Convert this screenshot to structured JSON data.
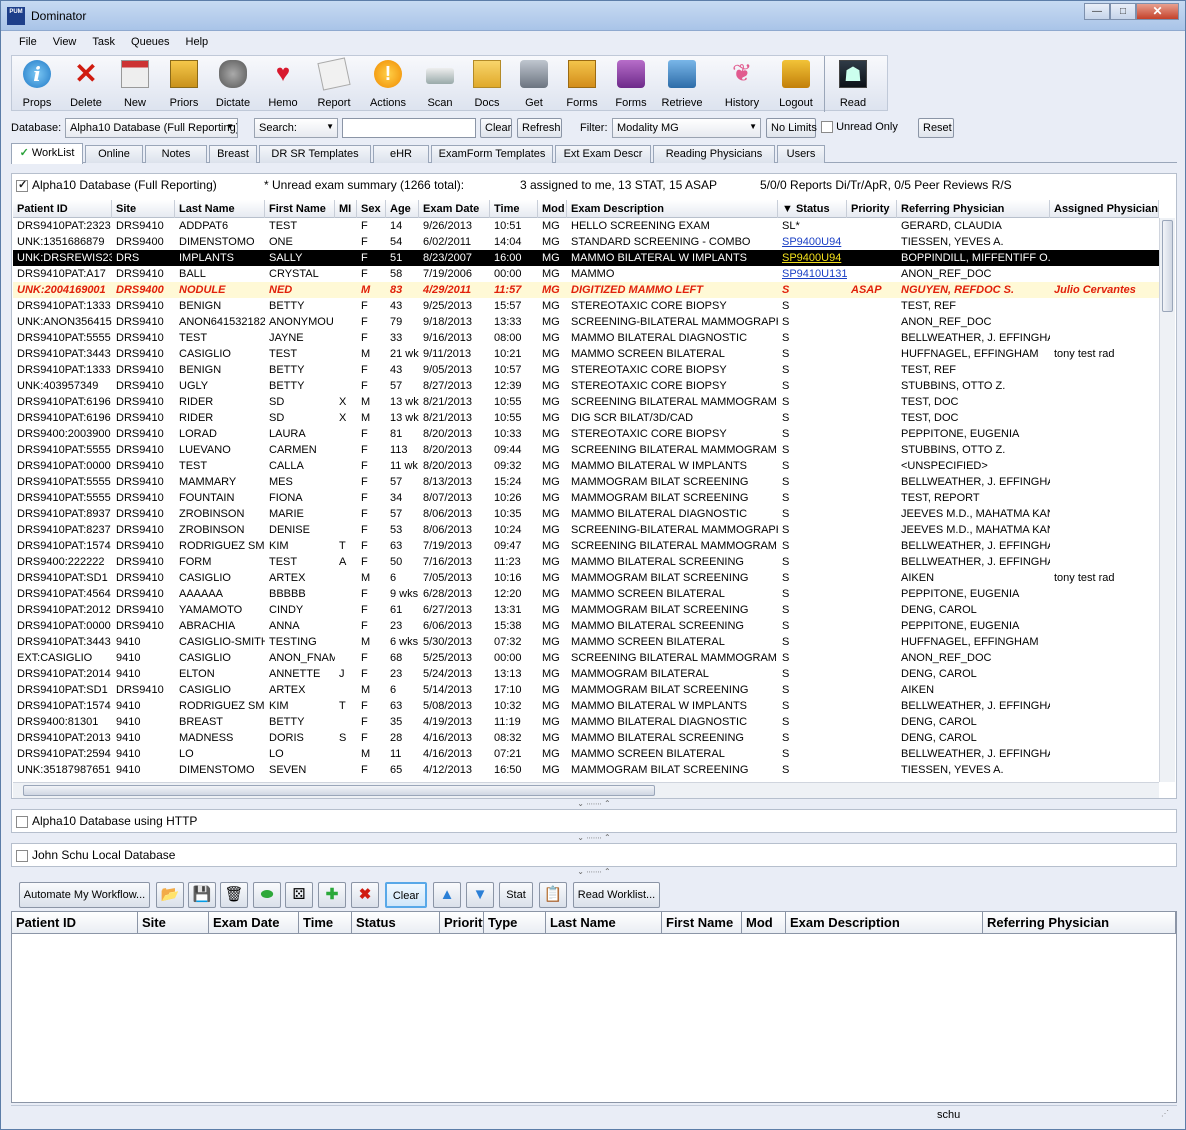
{
  "window": {
    "title": "Dominator",
    "logo": "PUM",
    "btn_min": "—",
    "btn_max": "□",
    "btn_close": "✕"
  },
  "menu": [
    "File",
    "View",
    "Task",
    "Queues",
    "Help"
  ],
  "toolbar": [
    {
      "label": "Props",
      "icon": "props-icon",
      "glyph": "i"
    },
    {
      "label": "Delete",
      "icon": "delete-icon",
      "glyph": "✕"
    },
    {
      "label": "New",
      "icon": "calendar-icon",
      "glyph": ""
    },
    {
      "label": "Priors",
      "icon": "folder-icon",
      "glyph": ""
    },
    {
      "label": "Dictate",
      "icon": "microphone-icon",
      "glyph": ""
    },
    {
      "label": "Hemo",
      "icon": "heart-icon",
      "glyph": "♥"
    },
    {
      "label": "Report",
      "icon": "report-icon",
      "glyph": ""
    },
    {
      "label": "Actions",
      "icon": "exclamation-icon",
      "glyph": "!"
    },
    {
      "label": "Scan",
      "icon": "scanner-icon",
      "glyph": ""
    },
    {
      "label": "Docs",
      "icon": "docs-icon",
      "glyph": ""
    },
    {
      "label": "Get",
      "icon": "camera-icon",
      "glyph": ""
    },
    {
      "label": "Forms",
      "icon": "forms-icon",
      "glyph": ""
    },
    {
      "label": "Forms",
      "icon": "print-forms-icon",
      "glyph": ""
    },
    {
      "label": "Retrieve",
      "icon": "retrieve-icon",
      "glyph": ""
    },
    {
      "label": "History",
      "icon": "ribbon-icon",
      "glyph": "❦"
    },
    {
      "label": "Logout",
      "icon": "lock-icon",
      "glyph": ""
    },
    {
      "label": "Read",
      "icon": "xray-icon",
      "glyph": "☗"
    }
  ],
  "filterbar": {
    "database_label": "Database:",
    "database_value": "Alpha10 Database (Full Reporting)",
    "search_dropdown": "Search:",
    "search_value": "",
    "clear": "Clear",
    "refresh": "Refresh",
    "filter_label": "Filter:",
    "filter_value": "Modality MG",
    "no_limits": "No Limits",
    "unread_only": "Unread Only",
    "reset": "Reset"
  },
  "tabs": [
    "WorkList",
    "Online",
    "Notes",
    "Breast",
    "DR SR Templates",
    "eHR",
    "ExamForm Templates",
    "Ext Exam Descr",
    "Reading Physicians",
    "Users"
  ],
  "section1": {
    "title": "Alpha10 Database (Full Reporting)",
    "summary1": "* Unread exam summary (1266 total):",
    "summary2": "3 assigned to me, 13 STAT, 15 ASAP",
    "summary3": "5/0/0 Reports Di/Tr/ApR, 0/5 Peer Reviews R/S"
  },
  "columns": [
    "Patient ID",
    "Site",
    "Last Name",
    "First Name",
    "MI",
    "Sex",
    "Age",
    "Exam Date",
    "Time",
    "Mod",
    "Exam Description",
    "▼ Status",
    "Priority",
    "Referring Physician",
    "Assigned Physician"
  ],
  "rows": [
    [
      "DRS9410PAT:2323",
      "DRS9410",
      "ADDPAT6",
      "TEST",
      "",
      "F",
      "14",
      "9/26/2013",
      "10:51",
      "MG",
      "HELLO SCREENING EXAM",
      "SL*",
      "",
      "GERARD, CLAUDIA",
      ""
    ],
    [
      "UNK:1351686879",
      "DRS9400",
      "DIMENSTOMO",
      "ONE",
      "",
      "F",
      "54",
      "6/02/2011",
      "14:04",
      "MG",
      "STANDARD SCREENING - COMBO",
      "SP9400U94",
      "",
      "TIESSEN, YEVES A.",
      ""
    ],
    [
      "UNK:DRSREWIS23",
      "DRS",
      "IMPLANTS",
      "SALLY",
      "",
      "F",
      "51",
      "8/23/2007",
      "16:00",
      "MG",
      "MAMMO BILATERAL W IMPLANTS",
      "SP9400U94",
      "",
      "BOPPINDILL, MIFFENTIFF O.",
      ""
    ],
    [
      "DRS9410PAT:A17",
      "DRS9410",
      "BALL",
      "CRYSTAL",
      "",
      "F",
      "58",
      "7/19/2006",
      "00:00",
      "MG",
      "MAMMO",
      "SP9410U131",
      "",
      "ANON_REF_DOC",
      ""
    ],
    [
      "UNK:2004169001",
      "DRS9400",
      "NODULE",
      "NED",
      "",
      "M",
      "83",
      "4/29/2011",
      "11:57",
      "MG",
      "DIGITIZED MAMMO LEFT",
      "S",
      "ASAP",
      "NGUYEN, REFDOC S.",
      "Julio Cervantes"
    ],
    [
      "DRS9410PAT:1333",
      "DRS9410",
      "BENIGN",
      "BETTY",
      "",
      "F",
      "43",
      "9/25/2013",
      "15:57",
      "MG",
      "STEREOTAXIC CORE BIOPSY",
      "S",
      "",
      "TEST, REF",
      ""
    ],
    [
      "UNK:ANON356415",
      "DRS9410",
      "ANON641532182",
      "ANONYMOU",
      "",
      "F",
      "79",
      "9/18/2013",
      "13:33",
      "MG",
      "SCREENING-BILATERAL MAMMOGRAPHY",
      "S",
      "",
      "ANON_REF_DOC",
      ""
    ],
    [
      "DRS9410PAT:5555",
      "DRS9410",
      "TEST",
      "JAYNE",
      "",
      "F",
      "33",
      "9/16/2013",
      "08:00",
      "MG",
      "MAMMO BILATERAL DIAGNOSTIC",
      "S",
      "",
      "BELLWEATHER, J. EFFINGHA",
      ""
    ],
    [
      "DRS9410PAT:3443",
      "DRS9410",
      "CASIGLIO",
      "TEST",
      "",
      "M",
      "21 wk",
      "9/11/2013",
      "10:21",
      "MG",
      "MAMMO SCREEN BILATERAL",
      "S",
      "",
      "HUFFNAGEL, EFFINGHAM",
      "tony test rad"
    ],
    [
      "DRS9410PAT:1333",
      "DRS9410",
      "BENIGN",
      "BETTY",
      "",
      "F",
      "43",
      "9/05/2013",
      "10:57",
      "MG",
      "STEREOTAXIC CORE BIOPSY",
      "S",
      "",
      "TEST, REF",
      ""
    ],
    [
      "UNK:403957349",
      "DRS9410",
      "UGLY",
      "BETTY",
      "",
      "F",
      "57",
      "8/27/2013",
      "12:39",
      "MG",
      "STEREOTAXIC CORE BIOPSY",
      "S",
      "",
      "STUBBINS, OTTO Z.",
      ""
    ],
    [
      "DRS9410PAT:6196",
      "DRS9410",
      "RIDER",
      "SD",
      "X",
      "M",
      "13 wk",
      "8/21/2013",
      "10:55",
      "MG",
      "SCREENING BILATERAL MAMMOGRAM",
      "S",
      "",
      "TEST, DOC",
      ""
    ],
    [
      "DRS9410PAT:6196",
      "DRS9410",
      "RIDER",
      "SD",
      "X",
      "M",
      "13 wk",
      "8/21/2013",
      "10:55",
      "MG",
      "DIG SCR BILAT/3D/CAD",
      "S",
      "",
      "TEST, DOC",
      ""
    ],
    [
      "DRS9400:2003900",
      "DRS9410",
      "LORAD",
      "LAURA",
      "",
      "F",
      "81",
      "8/20/2013",
      "10:33",
      "MG",
      "STEREOTAXIC CORE BIOPSY",
      "S",
      "",
      "PEPPITONE, EUGENIA",
      ""
    ],
    [
      "DRS9410PAT:5555",
      "DRS9410",
      "LUEVANO",
      "CARMEN",
      "",
      "F",
      "113",
      "8/20/2013",
      "09:44",
      "MG",
      "SCREENING BILATERAL MAMMOGRAM",
      "S",
      "",
      "STUBBINS, OTTO Z.",
      ""
    ],
    [
      "DRS9410PAT:0000",
      "DRS9410",
      "TEST",
      "CALLA",
      "",
      "F",
      "11 wk",
      "8/20/2013",
      "09:32",
      "MG",
      "MAMMO BILATERAL W IMPLANTS",
      "S",
      "",
      "<UNSPECIFIED>",
      ""
    ],
    [
      "DRS9410PAT:5555",
      "DRS9410",
      "MAMMARY",
      "MES",
      "",
      "F",
      "57",
      "8/13/2013",
      "15:24",
      "MG",
      "MAMMOGRAM BILAT SCREENING",
      "S",
      "",
      "BELLWEATHER, J. EFFINGHA",
      ""
    ],
    [
      "DRS9410PAT:5555",
      "DRS9410",
      "FOUNTAIN",
      "FIONA",
      "",
      "F",
      "34",
      "8/07/2013",
      "10:26",
      "MG",
      "MAMMOGRAM BILAT SCREENING",
      "S",
      "",
      "TEST, REPORT",
      ""
    ],
    [
      "DRS9410PAT:8937",
      "DRS9410",
      "ZROBINSON",
      "MARIE",
      "",
      "F",
      "57",
      "8/06/2013",
      "10:35",
      "MG",
      "MAMMO BILATERAL DIAGNOSTIC",
      "S",
      "",
      "JEEVES M.D., MAHATMA KAN",
      ""
    ],
    [
      "DRS9410PAT:8237",
      "DRS9410",
      "ZROBINSON",
      "DENISE",
      "",
      "F",
      "53",
      "8/06/2013",
      "10:24",
      "MG",
      "SCREENING-BILATERAL MAMMOGRAPHY",
      "S",
      "",
      "JEEVES M.D., MAHATMA KAN",
      ""
    ],
    [
      "DRS9410PAT:1574",
      "DRS9410",
      "RODRIGUEZ SMIT",
      "KIM",
      "T",
      "F",
      "63",
      "7/19/2013",
      "09:47",
      "MG",
      "SCREENING BILATERAL MAMMOGRAM",
      "S",
      "",
      "BELLWEATHER, J. EFFINGHA",
      ""
    ],
    [
      "DRS9400:222222",
      "DRS9410",
      "FORM",
      "TEST",
      "A",
      "F",
      "50",
      "7/16/2013",
      "11:23",
      "MG",
      "MAMMO BILATERAL SCREENING",
      "S",
      "",
      "BELLWEATHER, J. EFFINGHA",
      ""
    ],
    [
      "DRS9410PAT:SD1",
      "DRS9410",
      "CASIGLIO",
      "ARTEX",
      "",
      "M",
      "6",
      "7/05/2013",
      "10:16",
      "MG",
      "MAMMOGRAM BILAT SCREENING",
      "S",
      "",
      "AIKEN",
      "tony test rad"
    ],
    [
      "DRS9410PAT:4564",
      "DRS9410",
      "AAAAAA",
      "BBBBB",
      "",
      "F",
      "9 wks",
      "6/28/2013",
      "12:20",
      "MG",
      "MAMMO SCREEN BILATERAL",
      "S",
      "",
      "PEPPITONE, EUGENIA",
      ""
    ],
    [
      "DRS9410PAT:2012",
      "DRS9410",
      "YAMAMOTO",
      "CINDY",
      "",
      "F",
      "61",
      "6/27/2013",
      "13:31",
      "MG",
      "MAMMOGRAM BILAT SCREENING",
      "S",
      "",
      "DENG, CAROL",
      ""
    ],
    [
      "DRS9410PAT:0000",
      "DRS9410",
      "ABRACHIA",
      "ANNA",
      "",
      "F",
      "23",
      "6/06/2013",
      "15:38",
      "MG",
      "MAMMO BILATERAL SCREENING",
      "S",
      "",
      "PEPPITONE, EUGENIA",
      ""
    ],
    [
      "DRS9410PAT:3443",
      "9410",
      "CASIGLIO-SMITH",
      "TESTING",
      "",
      "M",
      "6 wks",
      "5/30/2013",
      "07:32",
      "MG",
      "MAMMO SCREEN BILATERAL",
      "S",
      "",
      "HUFFNAGEL, EFFINGHAM",
      ""
    ],
    [
      "EXT:CASIGLIO",
      "9410",
      "CASIGLIO",
      "ANON_FNAM",
      "",
      "F",
      "68",
      "5/25/2013",
      "00:00",
      "MG",
      "SCREENING BILATERAL MAMMOGRAM",
      "S",
      "",
      "ANON_REF_DOC",
      ""
    ],
    [
      "DRS9410PAT:2014",
      "9410",
      "ELTON",
      "ANNETTE",
      "J",
      "F",
      "23",
      "5/24/2013",
      "13:13",
      "MG",
      "MAMMOGRAM BILATERAL",
      "S",
      "",
      "DENG, CAROL",
      ""
    ],
    [
      "DRS9410PAT:SD1",
      "DRS9410",
      "CASIGLIO",
      "ARTEX",
      "",
      "M",
      "6",
      "5/14/2013",
      "17:10",
      "MG",
      "MAMMOGRAM BILAT SCREENING",
      "S",
      "",
      "AIKEN",
      ""
    ],
    [
      "DRS9410PAT:1574",
      "9410",
      "RODRIGUEZ SMIT",
      "KIM",
      "T",
      "F",
      "63",
      "5/08/2013",
      "10:32",
      "MG",
      "MAMMO BILATERAL W IMPLANTS",
      "S",
      "",
      "BELLWEATHER, J. EFFINGHA",
      ""
    ],
    [
      "DRS9400:81301",
      "9410",
      "BREAST",
      "BETTY",
      "",
      "F",
      "35",
      "4/19/2013",
      "11:19",
      "MG",
      "MAMMO BILATERAL DIAGNOSTIC",
      "S",
      "",
      "DENG, CAROL",
      ""
    ],
    [
      "DRS9410PAT:2013",
      "9410",
      "MADNESS",
      "DORIS",
      "S",
      "F",
      "28",
      "4/16/2013",
      "08:32",
      "MG",
      "MAMMO BILATERAL SCREENING",
      "S",
      "",
      "DENG, CAROL",
      ""
    ],
    [
      "DRS9410PAT:2594",
      "9410",
      "LO",
      "LO",
      "",
      "M",
      "11",
      "4/16/2013",
      "07:21",
      "MG",
      "MAMMO SCREEN BILATERAL",
      "S",
      "",
      "BELLWEATHER, J. EFFINGHA",
      ""
    ],
    [
      "UNK:35187987651",
      "9410",
      "DIMENSTOMO",
      "SEVEN",
      "",
      "F",
      "65",
      "4/12/2013",
      "16:50",
      "MG",
      "MAMMOGRAM BILAT SCREENING",
      "S",
      "",
      "TIESSEN, YEVES A.",
      ""
    ]
  ],
  "section2": {
    "title": "Alpha10 Database using HTTP"
  },
  "section3": {
    "title": "John Schu Local Database"
  },
  "splitter_glyph": "⌄ ∙∙∙∙∙∙∙ ⌃",
  "bottom_toolbar": {
    "automate": "Automate My Workflow...",
    "clear": "Clear",
    "stat": "Stat",
    "read_worklist": "Read Worklist..."
  },
  "bottom_columns": [
    "Patient ID",
    "Site",
    "Exam Date",
    "Time",
    "Status",
    "Priority",
    "Type",
    "Last Name",
    "First Name",
    "Mod",
    "Exam Description",
    "Referring Physician"
  ],
  "status": {
    "user": "schu"
  }
}
